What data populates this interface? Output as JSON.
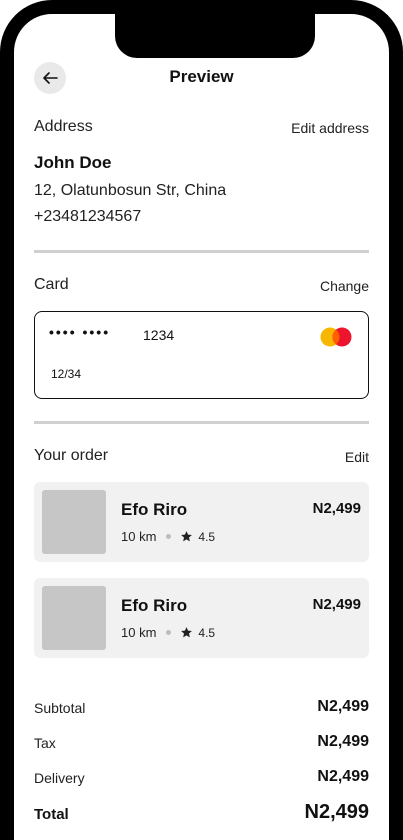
{
  "header": {
    "title": "Preview",
    "back_icon": "arrow-left-icon"
  },
  "address": {
    "label": "Address",
    "edit_label": "Edit address",
    "name": "John Doe",
    "street": "12, Olatunbosun Str, China",
    "phone": "+23481234567"
  },
  "card": {
    "label": "Card",
    "change_label": "Change",
    "masked": "•••• ••••",
    "last4": "1234",
    "expiry": "12/34",
    "brand_icon": "mastercard-icon",
    "brand_colors": [
      "#f7b600",
      "#eb001b"
    ]
  },
  "order": {
    "label": "Your order",
    "edit_label": "Edit",
    "items": [
      {
        "name": "Efo Riro",
        "price": "N2,499",
        "distance": "10 km",
        "rating": "4.5"
      },
      {
        "name": "Efo Riro",
        "price": "N2,499",
        "distance": "10 km",
        "rating": "4.5"
      }
    ]
  },
  "summary": {
    "subtotal_label": "Subtotal",
    "subtotal_value": "N2,499",
    "tax_label": "Tax",
    "tax_value": "N2,499",
    "delivery_label": "Delivery",
    "delivery_value": "N2,499",
    "total_label": "Total",
    "total_value": "N2,499"
  }
}
